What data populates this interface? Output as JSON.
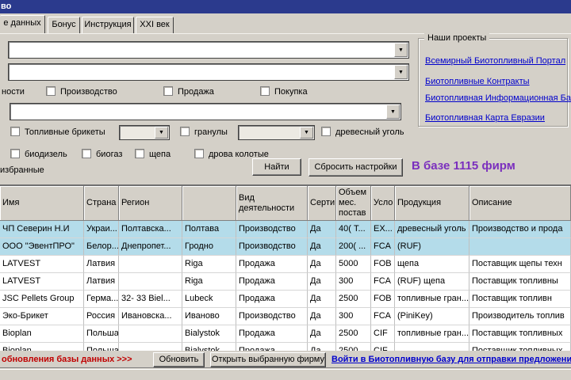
{
  "window": {
    "title": "во"
  },
  "tabs": [
    {
      "label": "е данных",
      "active": true
    },
    {
      "label": "Бонус",
      "active": false
    },
    {
      "label": "Инструкция",
      "active": false
    },
    {
      "label": "XXI век",
      "active": false
    }
  ],
  "filters": {
    "activity_label": "ности",
    "activities": [
      "Производство",
      "Продажа",
      "Покупка"
    ],
    "fuels": [
      "Топливные брикеты",
      "гранулы",
      "древесный уголь",
      "биодизель",
      "биогаз",
      "щепа",
      "дрова колотые"
    ],
    "favorites_label": "избранные",
    "find_button": "Найти",
    "reset_button": "Сбросить настройки",
    "count_text": "В базе 1115 фирм"
  },
  "projects": {
    "title": "Наши проекты",
    "links": [
      "Всемирный Биотопливный Портал",
      "Биотопливные Контракты",
      "Биотопливная Информационная База",
      "Биотопливная Карта Евразии"
    ]
  },
  "table": {
    "columns": [
      "Имя",
      "Страна",
      "Регион",
      "",
      "Вид деятельности",
      "Серти",
      "Объем мес. постав",
      "Усло",
      "Продукция",
      "Описание"
    ],
    "rows": [
      [
        "ЧП Северин Н.И",
        "Украи...",
        "Полтавска...",
        "Полтава",
        "Производство",
        "Да",
        "40( Т...",
        "EX...",
        "древесный уголь",
        "Производство и прода"
      ],
      [
        "ООО \"ЭвентПРО\"",
        "Белор...",
        "Днепропет...",
        "Гродно",
        "Производство",
        "Да",
        "200( ...",
        "FCA",
        "(RUF)",
        ""
      ],
      [
        "LATVEST",
        "Латвия",
        "",
        "Riga",
        "Продажа",
        "Да",
        "5000",
        "FOB",
        "щепа",
        "Поставщик щепы техн"
      ],
      [
        "LATVEST",
        "Латвия",
        "",
        "Riga",
        "Продажа",
        "Да",
        "300",
        "FCA",
        "(RUF) щепа",
        "Поставщик топливны"
      ],
      [
        "JSC Pellets Group",
        "Герма...",
        "32- 33  Biel...",
        "Lubeck",
        "Продажа",
        "Да",
        "2500",
        "FOB",
        "топливные гран...",
        "Поставщик топливн"
      ],
      [
        "Эко-Брикет",
        "Россия",
        "Ивановска...",
        "Иваново",
        "Производство",
        "Да",
        "300",
        "FCA",
        "(PiniKey)",
        "Производитель топлив"
      ],
      [
        "Bioplan",
        "Польша",
        "",
        "Bialystok",
        "Продажа",
        "Да",
        "2500",
        "CIF",
        "топливные гран...",
        "Поставщик топливных"
      ],
      [
        "Bioplan",
        "Польша",
        "",
        "Bialystok",
        "Продажа",
        "Да",
        "2500",
        "CIF",
        "",
        "Поставщик топливных"
      ]
    ],
    "highlighted_rows": [
      0,
      1
    ]
  },
  "footer": {
    "update_text": "обновления базы данных >>>",
    "refresh_button": "Обновить",
    "open_button": "Открыть выбранную фирму",
    "login_link": "Войти в Биотопливную базу для отправки предложений"
  },
  "colors": {
    "titlebar": "#2b3a8d",
    "highlight_row": "#b4dcea",
    "link_blue": "#0000cc",
    "alert_red": "#c00000",
    "accent_purple": "#7b2fbe",
    "window_gray": "#d4d0c8"
  }
}
